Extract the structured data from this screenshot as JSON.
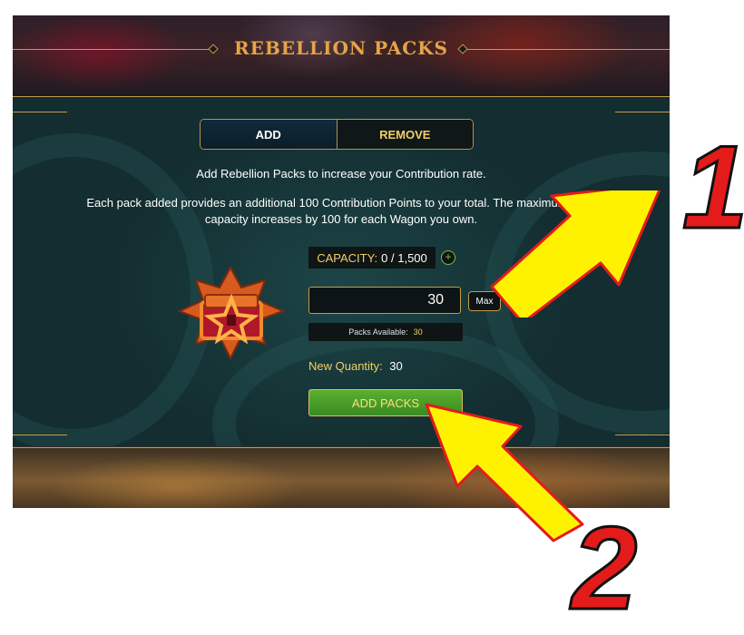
{
  "header": {
    "title": "REBELLION PACKS"
  },
  "tabs": [
    {
      "label": "ADD",
      "active": true
    },
    {
      "label": "REMOVE",
      "active": false
    }
  ],
  "info": {
    "line1": "Add Rebellion Packs to increase your Contribution rate.",
    "line2": "Each pack added provides an additional 100 Contribution Points to your total. The maximum pack",
    "line3": "capacity increases by 100 for each Wagon you own."
  },
  "capacity": {
    "label": "CAPACITY:",
    "value": "0 / 1,500",
    "add_symbol": "+"
  },
  "quantity": {
    "value": "30",
    "max_label": "Max"
  },
  "packs_available": {
    "label": "Packs Available:",
    "value": "30"
  },
  "new_quantity": {
    "label": "New Quantity:",
    "value": "30"
  },
  "actions": {
    "add_packs": "ADD PACKS"
  },
  "annotations": {
    "step1": "1",
    "step2": "2"
  },
  "icons": {
    "pack": "rebellion-pack-chest-icon",
    "capacity_add": "plus-circle-icon",
    "callout_arrows": "yellow-arrow-icon"
  },
  "colors": {
    "gold": "#e5a446",
    "text_gold": "#f1cf66",
    "button_green": "#4a9d28",
    "arrow_yellow": "#fff200",
    "step_red": "#e31b1b"
  }
}
